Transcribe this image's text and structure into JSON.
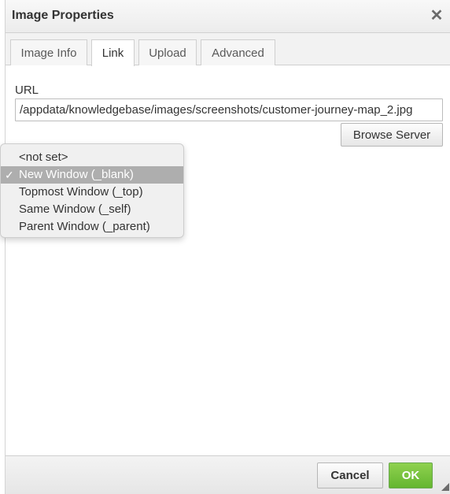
{
  "dialog": {
    "title": "Image Properties",
    "close_glyph": "✕"
  },
  "tabs": [
    {
      "label": "Image Info",
      "active": false
    },
    {
      "label": "Link",
      "active": true
    },
    {
      "label": "Upload",
      "active": false
    },
    {
      "label": "Advanced",
      "active": false
    }
  ],
  "link": {
    "url_label": "URL",
    "url_value": "/appdata/knowledgebase/images/screenshots/customer-journey-map_2.jpg",
    "browse_label": "Browse Server"
  },
  "target_dropdown": {
    "options": [
      "<not set>",
      "New Window (_blank)",
      "Topmost Window (_top)",
      "Same Window (_self)",
      "Parent Window (_parent)"
    ],
    "selected": "New Window (_blank)",
    "check_glyph": "✓"
  },
  "footer": {
    "cancel_label": "Cancel",
    "ok_label": "OK"
  },
  "colors": {
    "ok_button": "#64b62f",
    "selected_option": "#aeaeae"
  }
}
